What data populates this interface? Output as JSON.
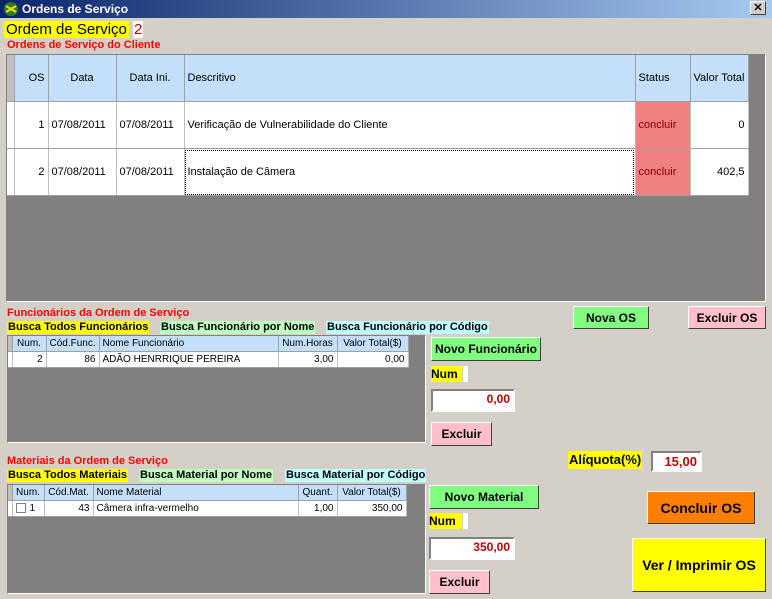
{
  "window": {
    "title": "Ordens de Serviço",
    "close_glyph": "✕"
  },
  "header": {
    "label": "Ordem de Serviço",
    "number": "2",
    "subtitle": "Ordens de Serviço do Cliente"
  },
  "os_table": {
    "columns": [
      "OS",
      "Data",
      "Data Ini.",
      "Descritivo",
      "Status",
      "Valor Total"
    ],
    "rows": [
      {
        "os": "1",
        "data": "07/08/2011",
        "data_ini": "07/08/2011",
        "descritivo": "Verificação de Vulnerabilidade do Cliente",
        "status": "concluir",
        "valor": "0"
      },
      {
        "os": "2",
        "data": "07/08/2011",
        "data_ini": "07/08/2011",
        "descritivo": "Instalação de Câmera",
        "status": "concluir",
        "valor": "402,5"
      }
    ]
  },
  "buttons": {
    "nova_os": "Nova OS",
    "excluir_os": "Excluir OS",
    "concluir_os": "Concluir OS",
    "imprimir_os": "Ver / Imprimir OS"
  },
  "funcionarios": {
    "title": "Funcionários da Ordem de Serviço",
    "tabs": [
      "Busca Todos Funcionários",
      "Busca Funcionário por Nome",
      "Busca Funcionário por Código"
    ],
    "columns": [
      "Num.",
      "Cód.Func.",
      "Nome Funcionário",
      "Num.Horas",
      "Valor Total($)"
    ],
    "rows": [
      {
        "num": "2",
        "cod": "86",
        "nome": "ADÃO HENRRIQUE PEREIRA",
        "horas": "3,00",
        "valor": "0,00"
      }
    ],
    "novo_label": "Novo Funcionário",
    "num_label": "Num",
    "total": "0,00",
    "excluir_label": "Excluir"
  },
  "materiais": {
    "title": "Materiais da Ordem de Serviço",
    "tabs": [
      "Busca Todos Materiais",
      "Busca Material por Nome",
      "Busca Material por Código"
    ],
    "columns": [
      "Num.",
      "Cód.Mat.",
      "Nome Material",
      "Quant.",
      "Valor Total($)"
    ],
    "rows": [
      {
        "num": "1",
        "cod": "43",
        "nome": "Câmera infra-vermelho",
        "quant": "1,00",
        "valor": "350,00"
      }
    ],
    "novo_label": "Novo Material",
    "num_label": "Num",
    "total": "350,00",
    "excluir_label": "Excluir"
  },
  "aliquota": {
    "label": "Alíquota(%)",
    "value": "15,00"
  },
  "colors": {
    "title_bar": "#0a246a",
    "grid_header": "#c4dff9",
    "status": "#f08080",
    "green_button": "#80ff80",
    "pink_button": "#ffc0cb",
    "orange_button": "#ff8000",
    "yellow": "#ffff00"
  }
}
